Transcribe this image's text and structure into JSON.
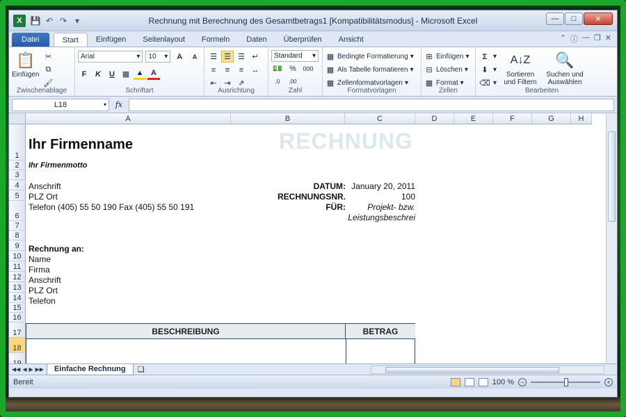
{
  "window": {
    "title": "Rechnung mit Berechnung des Gesamtbetrags1  [Kompatibilitätsmodus] - Microsoft Excel",
    "app_icon": "X"
  },
  "ribbon_tabs": [
    "Datei",
    "Start",
    "Einfügen",
    "Seitenlayout",
    "Formeln",
    "Daten",
    "Überprüfen",
    "Ansicht"
  ],
  "active_tab": "Start",
  "ribbon": {
    "clipboard": {
      "paste_label": "Einfügen",
      "group_label": "Zwischenablage"
    },
    "font": {
      "font_name": "Arial",
      "font_size": "10",
      "bold": "F",
      "italic": "K",
      "underline": "U",
      "group_label": "Schriftart"
    },
    "alignment": {
      "group_label": "Ausrichtung"
    },
    "number": {
      "format": "Standard",
      "percent": "%",
      "thousands": "000",
      "group_label": "Zahl"
    },
    "styles": {
      "conditional": "Bedingte Formatierung",
      "as_table": "Als Tabelle formatieren",
      "cell_styles": "Zellenformatvorlagen",
      "group_label": "Formatvorlagen"
    },
    "cells": {
      "insert": "Einfügen",
      "delete": "Löschen",
      "format": "Format",
      "group_label": "Zellen"
    },
    "editing": {
      "sigma": "Σ",
      "sort_line1": "Sortieren",
      "sort_line2": "und Filtern",
      "find_line1": "Suchen und",
      "find_line2": "Auswählen",
      "group_label": "Bearbeiten"
    }
  },
  "formula_bar": {
    "name_box": "L18",
    "fx": "fx",
    "formula": ""
  },
  "columns": [
    "A",
    "B",
    "C",
    "D",
    "E",
    "F",
    "G",
    "H"
  ],
  "rows": [
    "1",
    "2",
    "3",
    "4",
    "5",
    "6",
    "7",
    "8",
    "9",
    "10",
    "11",
    "12",
    "13",
    "14",
    "15",
    "16",
    "17",
    "18",
    "19"
  ],
  "selected_row": "18",
  "sheet": {
    "company_name": "Ihr Firmenname",
    "watermark": "RECHNUNG",
    "motto": "Ihr Firmenmotto",
    "address": "Anschrift",
    "zip_city": "PLZ Ort",
    "phone_fax": "Telefon (405) 55 50 190  Fax (405) 55 50 191",
    "date_label": "DATUM:",
    "date_value": "January 20, 2011",
    "invoice_no_label": "RECHNUNGSNR.",
    "invoice_no_value": "100",
    "for_label": "FÜR:",
    "for_value_line1": "Projekt- bzw.",
    "for_value_line2": "Leistungsbeschrei",
    "bill_to_label": "Rechnung an:",
    "bill_to_name": "Name",
    "bill_to_company": "Firma",
    "bill_to_address": "Anschrift",
    "bill_to_zip_city": "PLZ Ort",
    "bill_to_phone": "Telefon",
    "table_col_description": "BESCHREIBUNG",
    "table_col_amount": "BETRAG"
  },
  "sheet_tabs": {
    "active": "Einfache Rechnung"
  },
  "status": {
    "mode": "Bereit",
    "zoom": "100 %"
  }
}
